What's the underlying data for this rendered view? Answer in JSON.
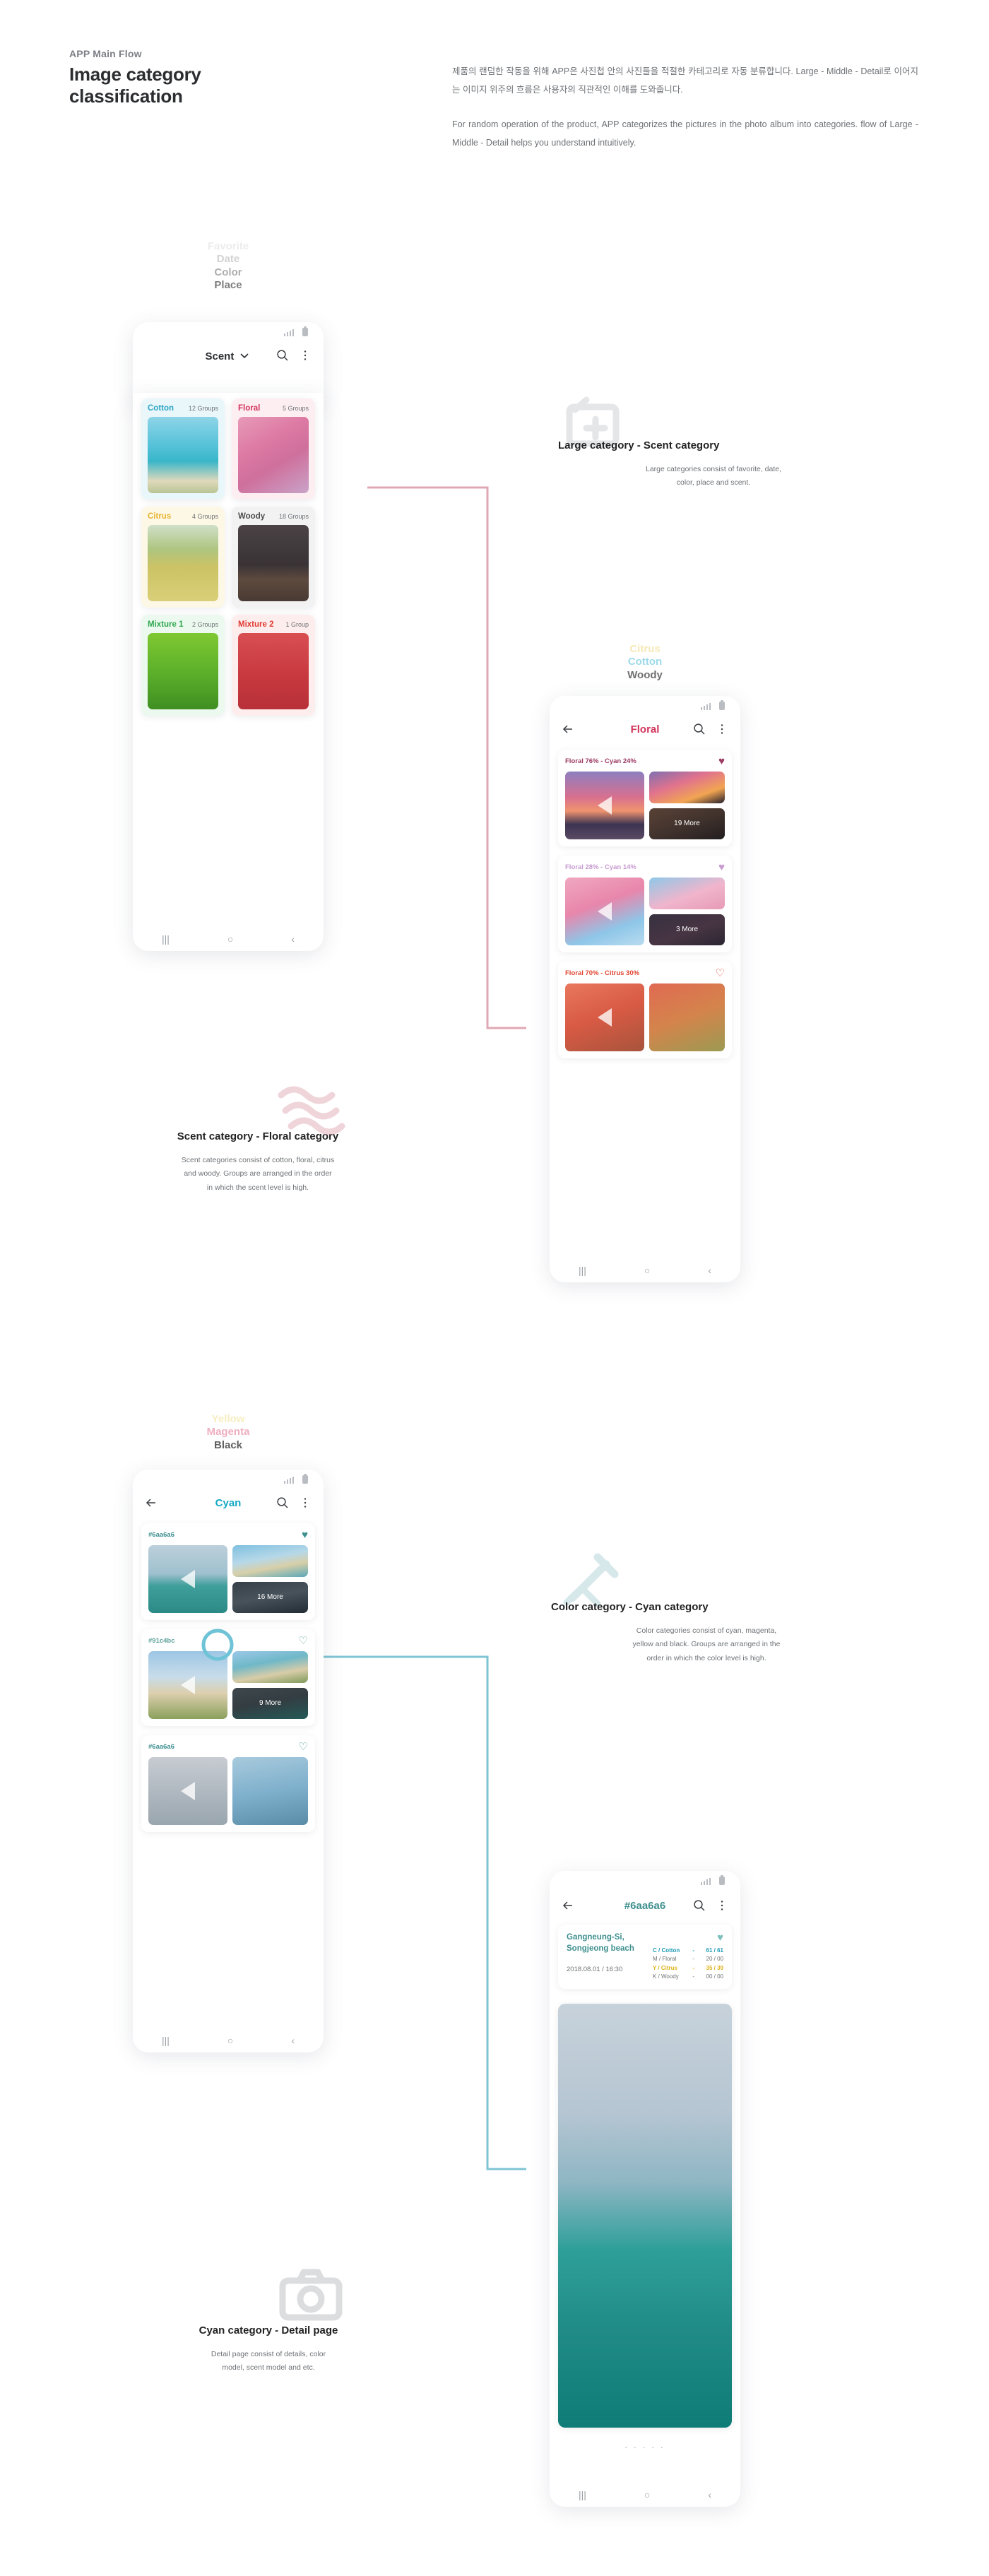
{
  "header": {
    "eyebrow": "APP Main Flow",
    "title": "Image category classification",
    "desc_ko": "제품의 랜덤한 작동을 위해 APP은 사진첩 안의 사진들을 적절한 카테고리로 자동 분류합니다. Large - Middle - Detail로 이어지는 이미지 위주의 흐름은 사용자의 직관적인 이해를 도와줍니다.",
    "desc_en": "For random operation of the product, APP categorizes the pictures in the photo album into categories. flow of Large - Middle - Detail helps you understand intuitively."
  },
  "colors": {
    "cotton": "#2aa5c4",
    "floral": "#d2325a",
    "citrus": "#e8b430",
    "woody": "#4c4c4c",
    "mixture1": "#2fa84f",
    "mixture2": "#e03a32",
    "cyan": "#14a8c4",
    "magenta": "#e8a2b4",
    "yellow": "#f2e2a0",
    "black": "#4c4c4c",
    "teal_detail": "#3f8f8f",
    "accent_pink": "#dca4ae",
    "accent_cyan": "#6fc3d6"
  },
  "phone1": {
    "ghost_menu": [
      {
        "label": "Favorite",
        "color": "#ececec"
      },
      {
        "label": "Date",
        "color": "#d2d2d2"
      },
      {
        "label": "Color",
        "color": "#aeaeae"
      },
      {
        "label": "Place",
        "color": "#7d7d7d"
      }
    ],
    "current": "Scent",
    "chevron": "chevron-down",
    "search_icon": "search-icon",
    "menu_icon": "more-vertical-icon",
    "cards": [
      {
        "name": "Cotton",
        "count": "12 Groups",
        "color": "#2aa5c4",
        "tint": "#e9f6fa",
        "img": "linear-gradient(180deg,#8ed4e8 0%,#4fc0d6 42%,#39b6c9 58%,#dfd9bb 84%,#b8c493 100%)"
      },
      {
        "name": "Floral",
        "count": "5 Groups",
        "color": "#d2325a",
        "tint": "#fdeef2",
        "img": "linear-gradient(150deg,#e79ab8 0%,#dd7aa4 35%,#cf6f9c 60%,#c9a3c8 100%)"
      },
      {
        "name": "Citrus",
        "count": "4 Groups",
        "color": "#e8b430",
        "tint": "#fdf7e6",
        "img": "linear-gradient(180deg,#cfe0c9 0%,#aec57f 32%,#ccc365 55%,#d9cf78 100%)"
      },
      {
        "name": "Woody",
        "count": "18 Groups",
        "color": "#4c4c4c",
        "tint": "#f2f2f2",
        "img": "linear-gradient(180deg,#4a4244 0%,#3a3336 52%,#5e4a3e 72%,#483a33 100%)"
      },
      {
        "name": "Mixture 1",
        "count": "2 Groups",
        "color": "#2fa84f",
        "tint": "#ecf9ef",
        "img": "linear-gradient(180deg,#7fc832 0%,#5db12a 50%,#3f8f22 100%)"
      },
      {
        "name": "Mixture 2",
        "count": "1 Group",
        "color": "#e03a32",
        "tint": "#fdeeed",
        "img": "linear-gradient(180deg,#d84f52 0%,#c8393f 55%,#b83038 100%)"
      }
    ],
    "nav": {
      "recents": "|||",
      "home": "○",
      "back": "‹"
    }
  },
  "phone2": {
    "ghost_menu": [
      {
        "label": "Citrus",
        "color": "#f6e9b8"
      },
      {
        "label": "Cotton",
        "color": "#9ddaea"
      },
      {
        "label": "Woody",
        "color": "#6f6f6f"
      }
    ],
    "current": "Floral",
    "back_icon": "arrow-left-icon",
    "search_icon": "search-icon",
    "menu_icon": "more-vertical-icon",
    "groups": [
      {
        "label": "Floral 76% - Cyan 24%",
        "color": "#9c3a63",
        "fav": true,
        "more": "19 More",
        "big": "linear-gradient(180deg,#8d7fc0 0%,#d8708f 38%,#f0936f 58%,#3c3452 78%,#5b4a63 100%)",
        "sm1": "linear-gradient(160deg,#7e6fb0 0%,#e0728e 38%,#f2a552 72%,#241f2c 100%)",
        "sm2": "linear-gradient(160deg,#8a6248 0%,#5c4436 55%,#2c2320 100%)"
      },
      {
        "label": "Floral 28% - Cyan 14%",
        "color": "#c79ad0",
        "fav": true,
        "more": "3 More",
        "big": "linear-gradient(160deg,#f0a8c0 0%,#e886ab 40%,#8ec6e8 72%,#b9dcf0 100%)",
        "sm1": "linear-gradient(160deg,#8fc8e8 0%,#f0b5cc 55%,#e79ab6 100%)",
        "sm2": "linear-gradient(160deg,#4c4458 0%,#6b4a5e 55%,#3a3342 100%)"
      },
      {
        "label": "Floral 70% - Citrus 30%",
        "color": "#e04632",
        "fav": false,
        "more": "",
        "big": "linear-gradient(160deg,#e8785e 0%,#d85a44 48%,#a8543c 100%)",
        "sm1": "linear-gradient(160deg,#e06a52 0%,#d4844c 50%,#9c9a52 100%)",
        "sm2": ""
      }
    ],
    "nav": {
      "recents": "|||",
      "home": "○",
      "back": "‹"
    }
  },
  "phone3": {
    "ghost_menu": [
      {
        "label": "Yellow",
        "color": "#f6eec0"
      },
      {
        "label": "Magenta",
        "color": "#eeafc0"
      },
      {
        "label": "Black",
        "color": "#5f5f5f"
      }
    ],
    "current": "Cyan",
    "back_icon": "arrow-left-icon",
    "search_icon": "search-icon",
    "menu_icon": "more-vertical-icon",
    "groups": [
      {
        "label": "#6aa6a6",
        "color": "#3f8f8f",
        "fav": true,
        "more": "16 More",
        "big": "linear-gradient(180deg,#bcd0da 0%,#9fc0cf 42%,#3f9f9a 60%,#2c8a86 100%)",
        "sm1": "linear-gradient(170deg,#7fc0e0 0%,#b6d8e8 42%,#d8cfa8 66%,#5aa8b8 100%)",
        "sm2": "linear-gradient(170deg,#4d5e68 0%,#6b7d86 48%,#2c3c44 100%)"
      },
      {
        "label": "#91c4bc",
        "color": "#5fa49c",
        "fav": false,
        "more": "9 More",
        "big": "linear-gradient(180deg,#9cc6e4 0%,#c8dcea 38%,#dccfae 62%,#8aa05c 100%)",
        "sm1": "linear-gradient(170deg,#9cc8e8 0%,#6fb8c8 38%,#d8cca8 68%,#7e9a5a 100%)",
        "sm2": "linear-gradient(170deg,#5a6a6e 0%,#48585c 46%,#2e8a80 100%)"
      },
      {
        "label": "#6aa6a6",
        "color": "#3f8f8f",
        "fav": false,
        "more": "",
        "big": "linear-gradient(180deg,#c8ccd2 0%,#b2bac2 45%,#9aa6ae 100%)",
        "sm1": "linear-gradient(170deg,#a8cadd 0%,#7fb0cc 50%,#5a8ca8 100%)",
        "sm2": ""
      }
    ],
    "nav": {
      "recents": "|||",
      "home": "○",
      "back": "‹"
    }
  },
  "phone4": {
    "title": "#6aa6a6",
    "back_icon": "arrow-left-icon",
    "search_icon": "search-icon",
    "menu_icon": "more-vertical-icon",
    "place": "Gangneung-Si,\nSongjeong beach",
    "date": "2018.08.01 / 16:30",
    "fav": true,
    "stats": [
      {
        "key": "C / Cotton",
        "dash": "-",
        "value": "61 / 61",
        "color": "#1d9ab5",
        "bold": true
      },
      {
        "key": "M / Floral",
        "dash": "-",
        "value": "20 / 00",
        "color": "#6e7276",
        "bold": false
      },
      {
        "key": "Y / Citrus",
        "dash": "-",
        "value": "35 / 39",
        "color": "#e0b21c",
        "bold": true
      },
      {
        "key": "K / Woody",
        "dash": "-",
        "value": "00 / 00",
        "color": "#6e7276",
        "bold": false
      }
    ],
    "pager": ". . . . .",
    "nav": {
      "recents": "|||",
      "home": "○",
      "back": "‹"
    }
  },
  "annotations": {
    "large": {
      "icon": "image-add-icon",
      "title": "Large category - Scent category",
      "body": "Large categories consist of favorite, date,\ncolor, place and scent."
    },
    "scent": {
      "icon": "scent-waves-icon",
      "title": "Scent category - Floral category",
      "body": "Scent categories consist of cotton, floral, citrus\nand woody. Groups are arranged in the order\nin which the scent level is high."
    },
    "color": {
      "icon": "color-brush-icon",
      "title": "Color category - Cyan category",
      "body": "Color categories consist of cyan, magenta,\nyellow and black.  Groups are arranged in the\norder in which the color level is high."
    },
    "detail": {
      "icon": "camera-icon",
      "title": "Cyan category - Detail page",
      "body": "Detail page consist of details, color\nmodel, scent model and etc."
    }
  }
}
